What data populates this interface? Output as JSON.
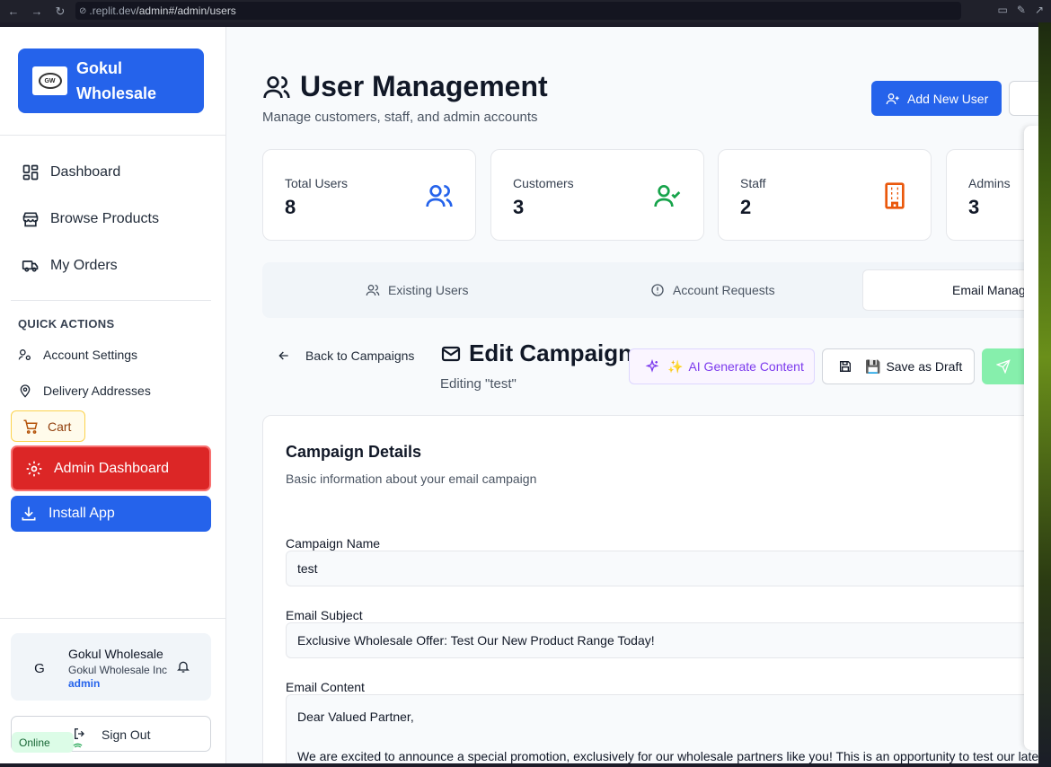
{
  "browser": {
    "url_host": ".replit.dev",
    "url_path": "/admin#/admin/users"
  },
  "sidebar": {
    "brand_line1": "Gokul",
    "brand_line2": "Wholesale",
    "brand_logo_text": "GW",
    "nav": [
      {
        "label": "Dashboard",
        "icon": "dashboard-icon"
      },
      {
        "label": "Browse Products",
        "icon": "store-icon"
      },
      {
        "label": "My Orders",
        "icon": "truck-icon"
      }
    ],
    "quick_actions_title": "QUICK ACTIONS",
    "quick_actions": [
      {
        "label": "Account Settings",
        "icon": "user-cog-icon"
      },
      {
        "label": "Delivery Addresses",
        "icon": "map-pin-icon"
      }
    ],
    "cart_label": "Cart",
    "admin_button": "Admin Dashboard",
    "install_button": "Install App",
    "user": {
      "avatar_initial": "G",
      "name": "Gokul Wholesale",
      "org": "Gokul Wholesale Inc",
      "role": "admin"
    },
    "online_label": "Online",
    "signout_label": "Sign Out"
  },
  "header": {
    "title": "User Management",
    "subtitle": "Manage customers, staff, and admin accounts",
    "add_user_button": "Add New User"
  },
  "stats": [
    {
      "label": "Total Users",
      "value": "8",
      "icon": "users-icon",
      "color": "#2563eb"
    },
    {
      "label": "Customers",
      "value": "3",
      "icon": "user-check-icon",
      "color": "#16a34a"
    },
    {
      "label": "Staff",
      "value": "2",
      "icon": "building-icon",
      "color": "#ea580c"
    },
    {
      "label": "Admins",
      "value": "3",
      "icon": "shield-icon",
      "color": "#7c3aed"
    }
  ],
  "tabs": [
    {
      "label": "Existing Users",
      "icon": "users-icon"
    },
    {
      "label": "Account Requests",
      "icon": "alert-circle-icon"
    },
    {
      "label": "Email Management",
      "icon": "mail-icon",
      "active": true
    }
  ],
  "editor": {
    "back_label": "Back to Campaigns",
    "title": "Edit Campaign",
    "subtitle": "Editing \"test\"",
    "ai_button": "AI Generate Content",
    "draft_button": "Save as Draft"
  },
  "campaign": {
    "card_title": "Campaign Details",
    "card_subtitle": "Basic information about your email campaign",
    "name_label": "Campaign Name",
    "name_value": "test",
    "subject_label": "Email Subject",
    "subject_value": "Exclusive Wholesale Offer: Test Our New Product Range Today!",
    "content_label": "Email Content",
    "content_value": "Dear Valued Partner,\n\nWe are excited to announce a special promotion, exclusively for our wholesale partners like you! This is an opportunity to test our latest product\nrange, designed to meet your diverse business needs."
  },
  "colors": {
    "primary": "#2563eb",
    "danger": "#dc2626",
    "ai_purple": "#7c3aed",
    "send_green": "#86efac"
  }
}
